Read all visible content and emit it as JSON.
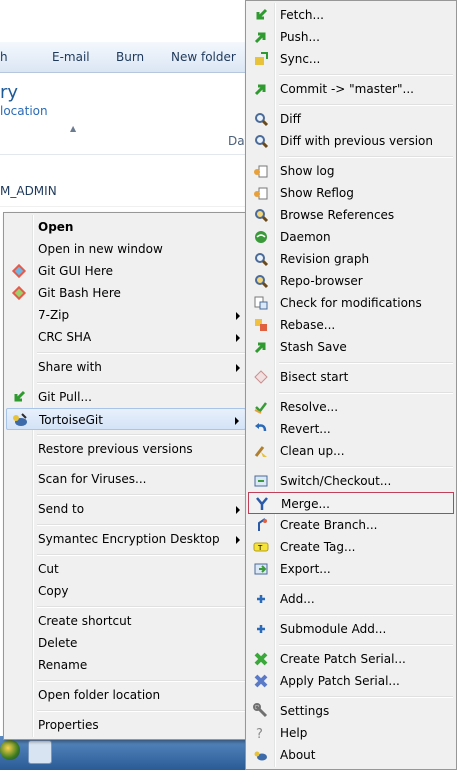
{
  "explorer": {
    "toolbar": [
      "h",
      "E-mail",
      "Burn",
      "New folder"
    ],
    "library_title": "ry",
    "library_subtitle": "location",
    "col_date": "Dat",
    "row_admin": "M_ADMIN"
  },
  "context_menu": {
    "items": [
      {
        "label": "Open",
        "bold": true
      },
      {
        "label": "Open in new window"
      },
      {
        "label": "Git GUI Here",
        "icon": "git-gui-icon"
      },
      {
        "label": "Git Bash Here",
        "icon": "git-bash-icon"
      },
      {
        "label": "7-Zip",
        "submenu": true
      },
      {
        "label": "CRC SHA",
        "submenu": true
      },
      {
        "label": "Share with",
        "submenu": true
      },
      {
        "label": "Git Pull...",
        "icon": "git-pull-icon"
      },
      {
        "label": "TortoiseGit",
        "icon": "tortoisegit-icon",
        "submenu": true
      },
      {
        "label": "Restore previous versions"
      },
      {
        "label": "Scan for Viruses..."
      },
      {
        "label": "Send to",
        "submenu": true
      },
      {
        "label": "Symantec Encryption Desktop",
        "submenu": true
      },
      {
        "label": "Cut"
      },
      {
        "label": "Copy"
      },
      {
        "label": "Create shortcut"
      },
      {
        "label": "Delete"
      },
      {
        "label": "Rename"
      },
      {
        "label": "Open folder location"
      },
      {
        "label": "Properties"
      }
    ]
  },
  "tortoise_menu": {
    "items": [
      {
        "label": "Fetch...",
        "icon": "fetch-icon"
      },
      {
        "label": "Push...",
        "icon": "push-icon"
      },
      {
        "label": "Sync...",
        "icon": "sync-icon"
      },
      {
        "label": "Commit -> \"master\"...",
        "icon": "commit-icon"
      },
      {
        "label": "Diff",
        "icon": "diff-icon"
      },
      {
        "label": "Diff with previous version",
        "icon": "diff-previous-icon"
      },
      {
        "label": "Show log",
        "icon": "show-log-icon"
      },
      {
        "label": "Show Reflog",
        "icon": "show-reflog-icon"
      },
      {
        "label": "Browse References",
        "icon": "browse-references-icon"
      },
      {
        "label": "Daemon",
        "icon": "daemon-icon"
      },
      {
        "label": "Revision graph",
        "icon": "revision-graph-icon"
      },
      {
        "label": "Repo-browser",
        "icon": "repo-browser-icon"
      },
      {
        "label": "Check for modifications",
        "icon": "check-modifications-icon"
      },
      {
        "label": "Rebase...",
        "icon": "rebase-icon"
      },
      {
        "label": "Stash Save",
        "icon": "stash-save-icon"
      },
      {
        "label": "Bisect start",
        "icon": "bisect-icon"
      },
      {
        "label": "Resolve...",
        "icon": "resolve-icon"
      },
      {
        "label": "Revert...",
        "icon": "revert-icon"
      },
      {
        "label": "Clean up...",
        "icon": "clean-up-icon"
      },
      {
        "label": "Switch/Checkout...",
        "icon": "switch-checkout-icon"
      },
      {
        "label": "Merge...",
        "icon": "merge-icon"
      },
      {
        "label": "Create Branch...",
        "icon": "create-branch-icon"
      },
      {
        "label": "Create Tag...",
        "icon": "create-tag-icon"
      },
      {
        "label": "Export...",
        "icon": "export-icon"
      },
      {
        "label": "Add...",
        "icon": "add-icon"
      },
      {
        "label": "Submodule Add...",
        "icon": "submodule-add-icon"
      },
      {
        "label": "Create Patch Serial...",
        "icon": "create-patch-icon"
      },
      {
        "label": "Apply Patch Serial...",
        "icon": "apply-patch-icon"
      },
      {
        "label": "Settings",
        "icon": "settings-icon"
      },
      {
        "label": "Help",
        "icon": "help-icon"
      },
      {
        "label": "About",
        "icon": "about-icon"
      }
    ]
  }
}
